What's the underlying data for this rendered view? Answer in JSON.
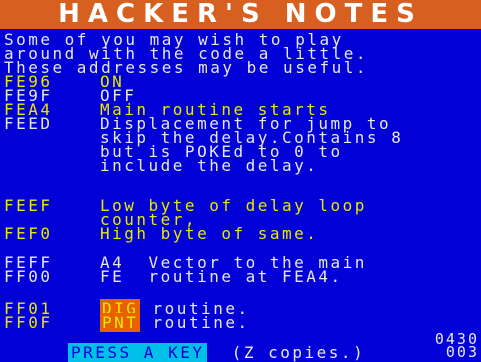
{
  "title": "HACKER'S NOTES",
  "intro": [
    "Some of you may wish to play",
    "around with the code a little.",
    "These addresses may be useful."
  ],
  "entries": [
    {
      "addr": "FE96",
      "desc": "ON"
    },
    {
      "addr": "FE9F",
      "desc": "OFF"
    },
    {
      "addr": "FEA4",
      "desc": "Main routine starts"
    },
    {
      "addr": "FEED",
      "desc": "Displacement for jump to"
    },
    {
      "addr": "",
      "desc": "skip the delay.Contains 8"
    },
    {
      "addr": "",
      "desc": "but is POKEd to 0 to"
    },
    {
      "addr": "",
      "desc": "include the delay."
    },
    {
      "addr": "FEEF",
      "desc": "Low byte of delay loop"
    },
    {
      "addr": "",
      "desc": "counter,"
    },
    {
      "addr": "FEF0",
      "desc": "High byte of same."
    },
    {
      "addr": "FEFF",
      "desc": "A4  Vector to the main"
    },
    {
      "addr": "FF00",
      "desc": "FE  routine at FEA4."
    },
    {
      "addr": "FF01",
      "hl": "DIG",
      "desc": " routine."
    },
    {
      "addr": "FF0F",
      "hl": "PNT",
      "desc": " routine."
    }
  ],
  "footer": {
    "press": "PRESS A KEY",
    "copies": "(Z copies.)",
    "counter_top": "0430",
    "counter_bottom": "003"
  }
}
